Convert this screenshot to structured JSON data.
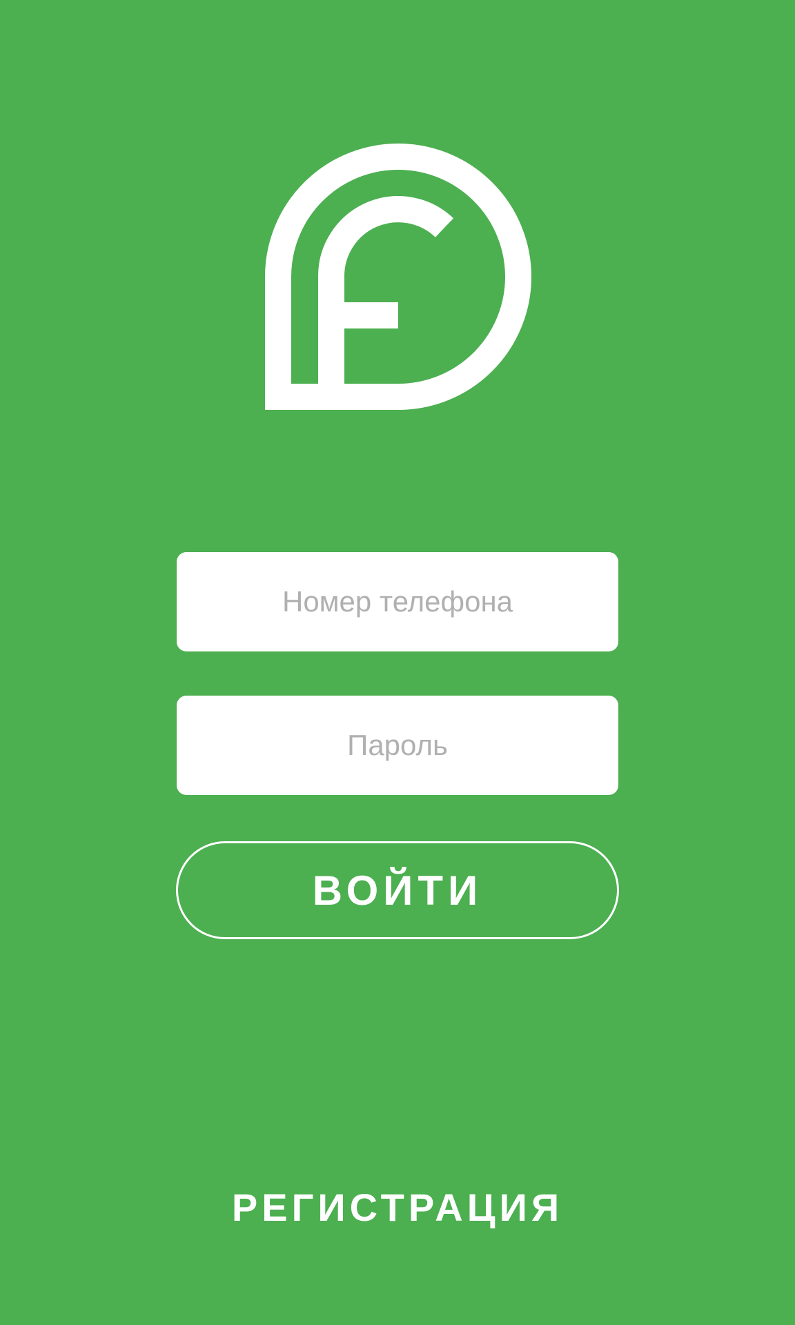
{
  "app": {
    "logo": "brand-f-logo-icon",
    "background_color": "#4caf50",
    "accent_color": "#ffffff"
  },
  "login_form": {
    "phone_placeholder": "Номер телефона",
    "phone_value": "",
    "password_placeholder": "Пароль",
    "password_value": "",
    "submit_label": "ВОЙТИ"
  },
  "footer": {
    "register_label": "РЕГИСТРАЦИЯ"
  }
}
